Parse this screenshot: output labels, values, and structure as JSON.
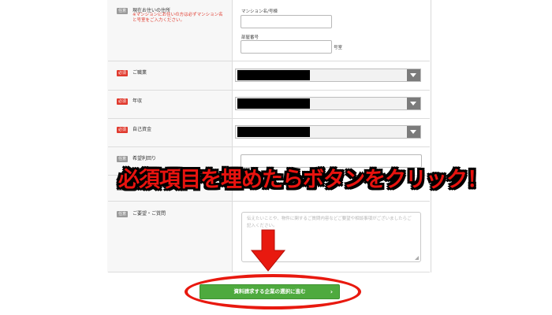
{
  "form": {
    "address": {
      "badge": "任意",
      "label": "現在お住いの住所",
      "note": "※マンションにお住いの方は必ずマンション名と号室をご入力ください。",
      "mansion_label": "マンション名/号棟",
      "room_label": "部屋番号",
      "room_suffix": "号室"
    },
    "occupation": {
      "badge": "必須",
      "label": "ご職業"
    },
    "annual_income": {
      "badge": "必須",
      "label": "年収"
    },
    "savings": {
      "badge": "必須",
      "label": "自己資金"
    },
    "desired_yield": {
      "badge": "任意",
      "label": "希望利回り"
    },
    "hidden_row": {
      "badge": "任意"
    },
    "requests": {
      "badge": "任意",
      "label": "ご要望・ご質問",
      "placeholder": "伝えたいことや、物件に関するご質問内容などご要望や相談事項がございましたらご記入ください。"
    }
  },
  "overlay_text": "必須項目を埋めたらボタンをクリック！",
  "submit": {
    "label": "資料請求する企業の選択に進む",
    "chevron": "›"
  },
  "colors": {
    "required": "#e03a2e",
    "optional": "#9a9a9a",
    "submit": "#4eaa3e",
    "highlight": "#e8190f"
  }
}
